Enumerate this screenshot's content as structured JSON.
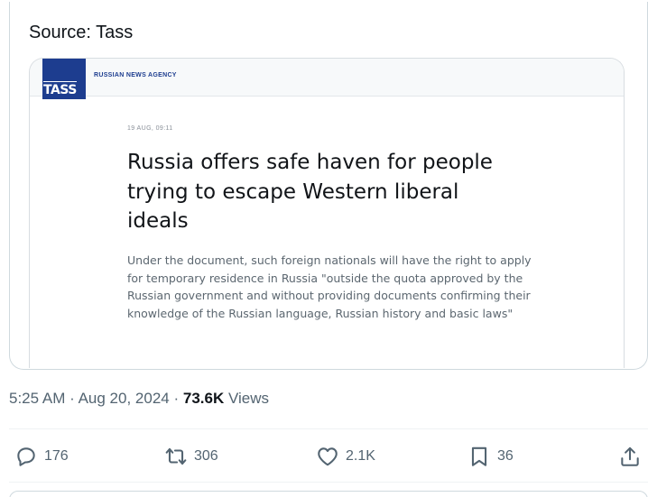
{
  "post": {
    "source_text": "Source: Tass"
  },
  "embedded_article": {
    "logo_text": "TASS",
    "agency_label": "RUSSIAN NEWS AGENCY",
    "dateline": "19 AUG, 09:11",
    "headline": "Russia offers safe haven for people trying to escape Western liberal ideals",
    "lede": "Under the document, such foreign nationals will have the right to apply for temporary residence in Russia \"outside the quota approved by the Russian government and without providing documents confirming their knowledge of the Russian language, Russian history and basic laws\"",
    "brand_color": "#1d3d8f"
  },
  "meta": {
    "time": "5:25 AM",
    "separator": "·",
    "date": "Aug 20, 2024",
    "views_count": "73.6K",
    "views_label": "Views"
  },
  "actions": {
    "replies": {
      "icon": "reply-icon",
      "count": "176"
    },
    "reposts": {
      "icon": "repost-icon",
      "count": "306"
    },
    "likes": {
      "icon": "heart-icon",
      "count": "2.1K"
    },
    "bookmarks": {
      "icon": "bookmark-icon",
      "count": "36"
    },
    "share": {
      "icon": "share-icon"
    }
  }
}
